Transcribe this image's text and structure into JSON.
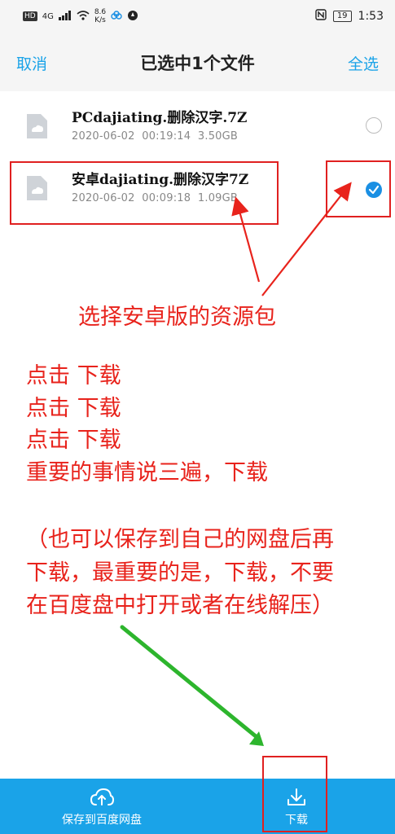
{
  "status_bar": {
    "network": "4G",
    "hd": "HD",
    "speed_value": "8.6",
    "speed_unit": "K/s",
    "battery": "19",
    "time": "1:53"
  },
  "header": {
    "cancel_label": "取消",
    "title": "已选中1个文件",
    "select_all_label": "全选"
  },
  "files": [
    {
      "name": "PCdajiating.删除汉字.7Z",
      "date": "2020-06-02",
      "time": "00:19:14",
      "size": "3.50GB",
      "selected": false
    },
    {
      "name": "安卓dajiating.删除汉字7Z",
      "date": "2020-06-02",
      "time": "00:09:18",
      "size": "1.09GB",
      "selected": true
    }
  ],
  "annotations": {
    "select_hint": "选择安卓版的资源包",
    "lines": [
      "点击  下载",
      "点击  下载",
      "点击  下载",
      "重要的事情说三遍，下载"
    ],
    "note_lines": [
      "（也可以保存到自己的网盘后再",
      "下载，最重要的是，下载，不要",
      "在百度盘中打开或者在线解压）"
    ],
    "colors": {
      "red": "#e8231c",
      "green": "#2db52d",
      "accent": "#1aa3e8"
    }
  },
  "bottom_bar": {
    "save_label": "保存到百度网盘",
    "download_label": "下载"
  }
}
